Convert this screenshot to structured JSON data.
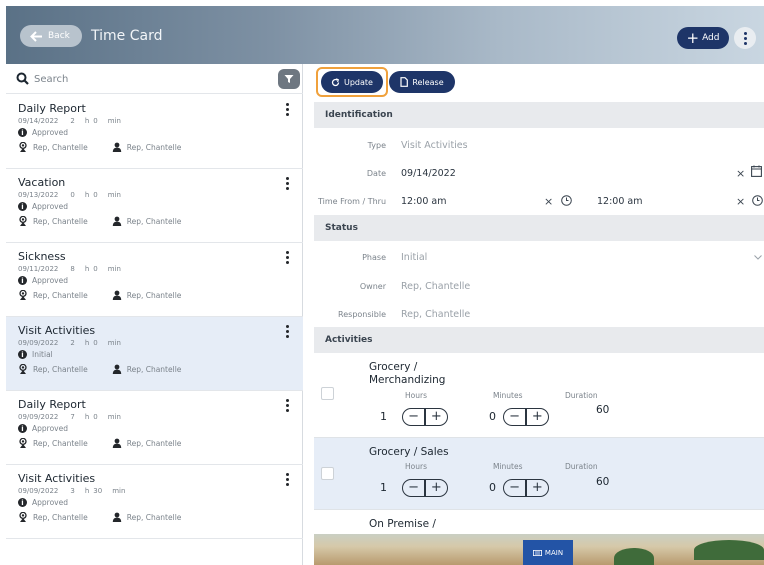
{
  "header": {
    "back_label": "Back",
    "title": "Time Card",
    "add_label": "Add"
  },
  "search": {
    "placeholder": "Search"
  },
  "list": [
    {
      "title": "Daily Report",
      "date": "09/14/2022",
      "hours": "2",
      "minutes": "0",
      "status": "Approved",
      "person1": "Rep, Chantelle",
      "person2": "Rep, Chantelle"
    },
    {
      "title": "Vacation",
      "date": "09/13/2022",
      "hours": "0",
      "minutes": "0",
      "status": "Approved",
      "person1": "Rep, Chantelle",
      "person2": "Rep, Chantelle"
    },
    {
      "title": "Sickness",
      "date": "09/11/2022",
      "hours": "8",
      "minutes": "0",
      "status": "Approved",
      "person1": "Rep, Chantelle",
      "person2": "Rep, Chantelle"
    },
    {
      "title": "Visit Activities",
      "date": "09/09/2022",
      "hours": "2",
      "minutes": "0",
      "status": "Initial",
      "person1": "Rep, Chantelle",
      "person2": "Rep, Chantelle"
    },
    {
      "title": "Daily Report",
      "date": "09/09/2022",
      "hours": "7",
      "minutes": "0",
      "status": "Approved",
      "person1": "Rep, Chantelle",
      "person2": "Rep, Chantelle"
    },
    {
      "title": "Visit Activities",
      "date": "09/09/2022",
      "hours": "3",
      "minutes": "30",
      "status": "Approved",
      "person1": "Rep, Chantelle",
      "person2": "Rep, Chantelle"
    }
  ],
  "units": {
    "h": "h",
    "min": "min"
  },
  "toolbar": {
    "update_label": "Update",
    "release_label": "Release"
  },
  "identification": {
    "heading": "Identification",
    "type_label": "Type",
    "type_value": "Visit Activities",
    "date_label": "Date",
    "date_value": "09/14/2022",
    "time_label": "Time From / Thru",
    "time_from": "12:00 am",
    "time_thru": "12:00 am"
  },
  "status": {
    "heading": "Status",
    "phase_label": "Phase",
    "phase_value": "Initial",
    "owner_label": "Owner",
    "owner_value": "Rep, Chantelle",
    "responsible_label": "Responsible",
    "responsible_value": "Rep, Chantelle"
  },
  "activities": {
    "heading": "Activities",
    "hours_label": "Hours",
    "minutes_label": "Minutes",
    "duration_label": "Duration",
    "items": [
      {
        "name_line1": "Grocery /",
        "name_line2": "Merchandizing",
        "hours": "1",
        "minutes": "0",
        "duration": "60"
      },
      {
        "name_line1": "Grocery / Sales",
        "name_line2": "",
        "hours": "1",
        "minutes": "0",
        "duration": "60"
      },
      {
        "name_line1": "On Premise /",
        "name_line2": "",
        "hours": "",
        "minutes": "",
        "duration": ""
      }
    ]
  },
  "bottom": {
    "main_label": "MAIN"
  },
  "colors": {
    "primary": "#1e3568",
    "highlight": "#f0a13c",
    "selected_row": "#e6edf7",
    "section_bg": "#e8eaed"
  }
}
